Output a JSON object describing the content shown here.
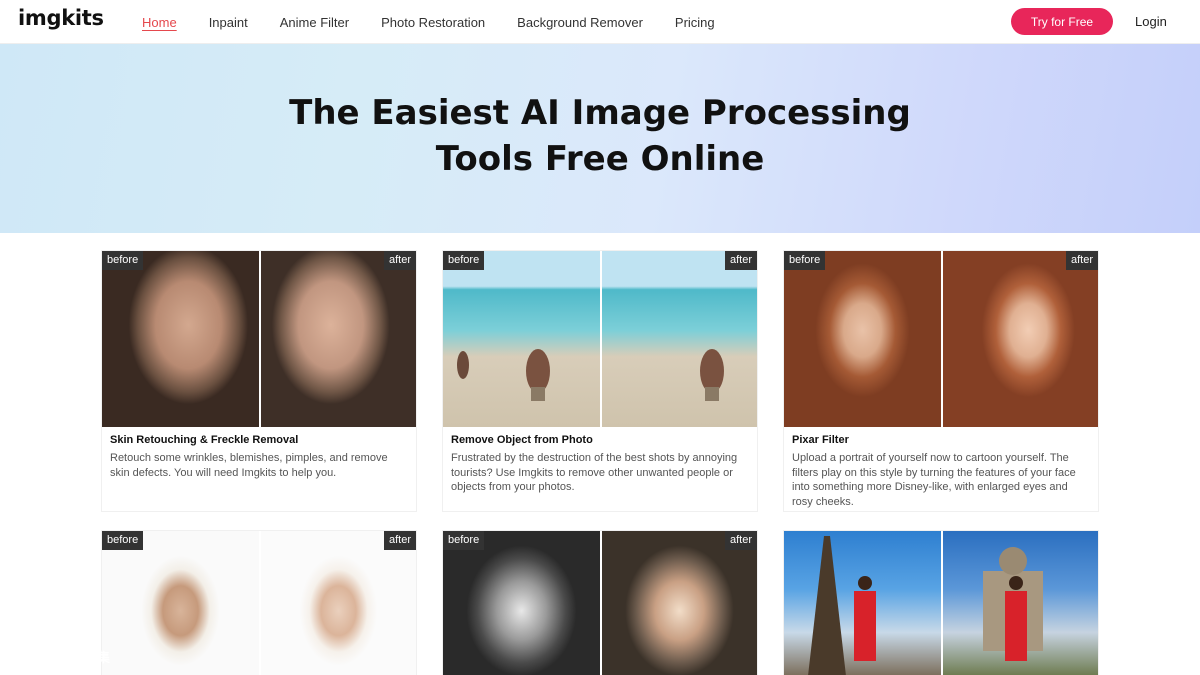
{
  "header": {
    "logo": "imgkits",
    "nav": [
      "Home",
      "Inpaint",
      "Anime Filter",
      "Photo Restoration",
      "Background Remover",
      "Pricing"
    ],
    "cta": "Try for Free",
    "login": "Login"
  },
  "hero": {
    "line1": "The Easiest AI Image Processing",
    "line2": "Tools Free Online"
  },
  "labels": {
    "before": "before",
    "after": "after"
  },
  "cards": [
    {
      "title": "Skin Retouching & Freckle Removal",
      "desc": "Retouch some wrinkles, blemishes, pimples, and remove skin defects. You will need Imgkits to help you."
    },
    {
      "title": "Remove Object from Photo",
      "desc": "Frustrated by the destruction of the best shots by annoying tourists? Use Imgkits to remove other unwanted people or objects from your photos."
    },
    {
      "title": "Pixar Filter",
      "desc": "Upload a portrait of yourself now to cartoon yourself. The filters play on this style by turning the features of your face into something more Disney-like, with enlarged eyes and rosy cheeks."
    }
  ],
  "watermark": {
    "line1": "ai-bot.cn",
    "line2": "AI工具集"
  },
  "colors": {
    "accent": "#e8265a",
    "active_nav": "#e5484d"
  }
}
